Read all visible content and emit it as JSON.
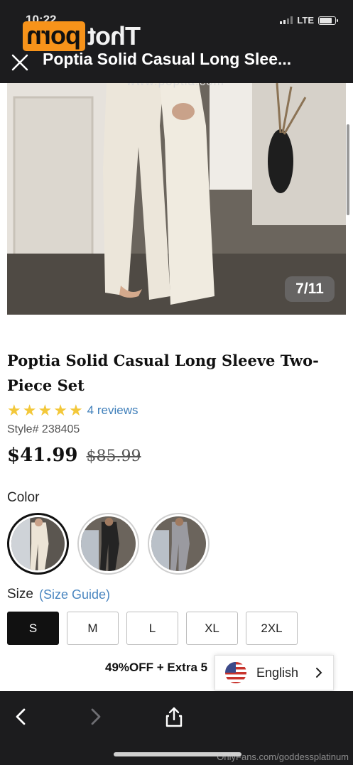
{
  "status_bar": {
    "time": "10:22",
    "network": "LTE"
  },
  "watermark_logo": {
    "part1": "Thot",
    "part2": "porn"
  },
  "header": {
    "title": "Poptia Solid Casual Long Slee..."
  },
  "photo": {
    "site_watermark": "www.poptia.com",
    "counter": "7/11"
  },
  "product": {
    "title": "Poptia Solid Casual Long Sleeve Two-Piece Set",
    "rating": 5,
    "reviews": "4 reviews",
    "style": "Style# 238405",
    "price": "$41.99",
    "original_price": "$85.99"
  },
  "color": {
    "label": "Color",
    "options": [
      {
        "name": "Beige",
        "color": "#e8e1d6",
        "selected": true
      },
      {
        "name": "Black",
        "color": "#222222",
        "selected": false
      },
      {
        "name": "Gray",
        "color": "#9a9aa0",
        "selected": false
      }
    ]
  },
  "size": {
    "label": "Size",
    "guide": "(Size Guide)",
    "options": [
      "S",
      "M",
      "L",
      "XL",
      "2XL"
    ],
    "selected": "S"
  },
  "promo": {
    "text": "49%OFF + Extra 5"
  },
  "language": {
    "label": "English"
  },
  "footer": {
    "onlyfans_watermark": "OnlyFans.com/goddessplatinum"
  },
  "colors": {
    "chrome": "#1c1c1e",
    "star": "#f3c83a",
    "link": "#3f7fba",
    "brand_orange": "#f7931a"
  }
}
